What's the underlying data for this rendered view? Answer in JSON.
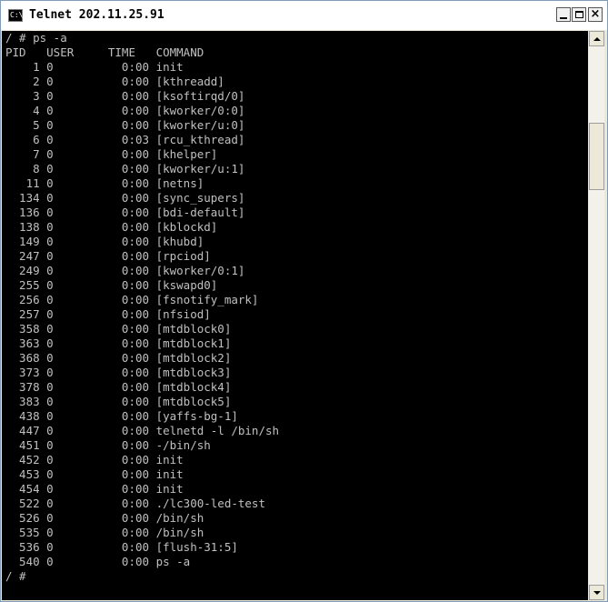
{
  "window": {
    "title": "Telnet 202.11.25.91",
    "icon_text": "C:\\",
    "controls": [
      "minimize",
      "maximize",
      "close"
    ]
  },
  "terminal": {
    "lines": [
      "/ # ps -a",
      "PID   USER     TIME   COMMAND",
      "    1 0          0:00 init",
      "    2 0          0:00 [kthreadd]",
      "    3 0          0:00 [ksoftirqd/0]",
      "    4 0          0:00 [kworker/0:0]",
      "    5 0          0:00 [kworker/u:0]",
      "    6 0          0:03 [rcu_kthread]",
      "    7 0          0:00 [khelper]",
      "    8 0          0:00 [kworker/u:1]",
      "   11 0          0:00 [netns]",
      "  134 0          0:00 [sync_supers]",
      "  136 0          0:00 [bdi-default]",
      "  138 0          0:00 [kblockd]",
      "  149 0          0:00 [khubd]",
      "  247 0          0:00 [rpciod]",
      "  249 0          0:00 [kworker/0:1]",
      "  255 0          0:00 [kswapd0]",
      "  256 0          0:00 [fsnotify_mark]",
      "  257 0          0:00 [nfsiod]",
      "  358 0          0:00 [mtdblock0]",
      "  363 0          0:00 [mtdblock1]",
      "  368 0          0:00 [mtdblock2]",
      "  373 0          0:00 [mtdblock3]",
      "  378 0          0:00 [mtdblock4]",
      "  383 0          0:00 [mtdblock5]",
      "  438 0          0:00 [yaffs-bg-1]",
      "  447 0          0:00 telnetd -l /bin/sh",
      "  451 0          0:00 -/bin/sh",
      "  452 0          0:00 init",
      "  453 0          0:00 init",
      "  454 0          0:00 init",
      "  522 0          0:00 ./lc300-led-test",
      "  526 0          0:00 /bin/sh",
      "  535 0          0:00 /bin/sh",
      "  536 0          0:00 [flush-31:5]",
      "  540 0          0:00 ps -a",
      "/ # "
    ],
    "colors": {
      "background": "#000000",
      "foreground": "#c0c0c0"
    }
  }
}
